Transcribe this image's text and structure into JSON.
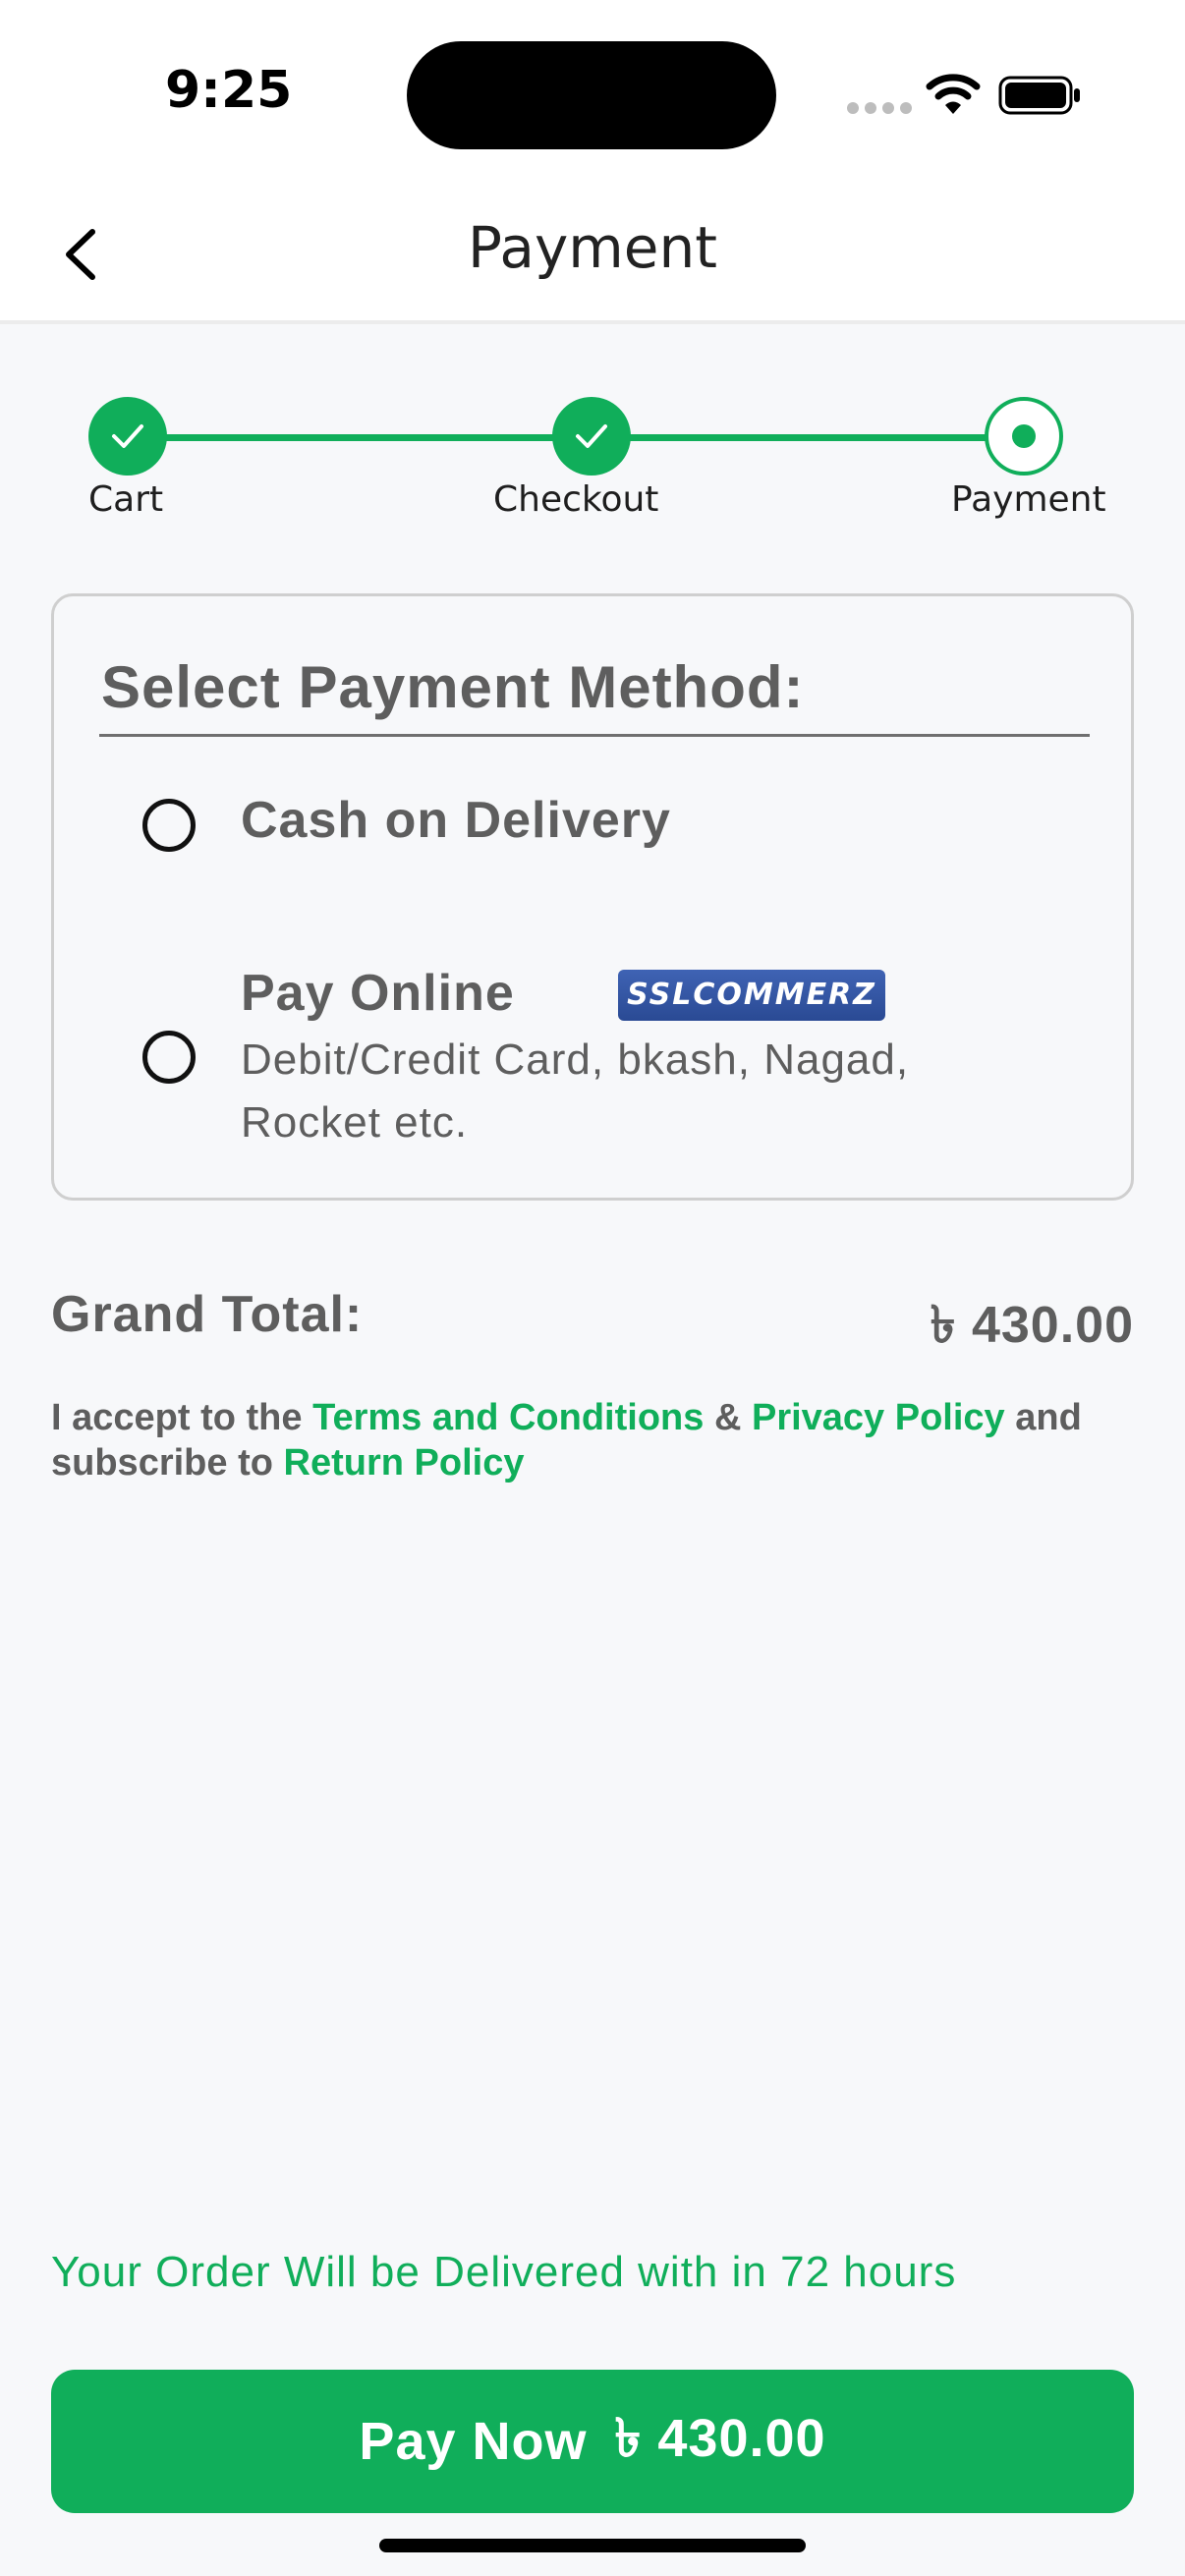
{
  "status_bar": {
    "time": "9:25"
  },
  "nav": {
    "title": "Payment",
    "back_icon": "chevron-left-icon"
  },
  "stepper": {
    "accent_color": "#10ae5a",
    "steps": [
      {
        "label": "Cart",
        "state": "done"
      },
      {
        "label": "Checkout",
        "state": "done"
      },
      {
        "label": "Payment",
        "state": "current"
      }
    ]
  },
  "payment_card": {
    "heading": "Select Payment Method:",
    "options": [
      {
        "title": "Cash on Delivery",
        "selected": false
      },
      {
        "title": "Pay Online",
        "badge": "SSLCOMMERZ",
        "subtitle_line1": "Debit/Credit Card, bkash, Nagad,",
        "subtitle_line2": "Rocket etc.",
        "selected": false
      }
    ]
  },
  "totals": {
    "grand_label": "Grand Total:",
    "grand_value": "৳ 430.00"
  },
  "terms": {
    "prefix": "I accept to the",
    "terms_link": "Terms and Conditions",
    "amp": "&",
    "privacy_link": "Privacy Policy",
    "and": "and",
    "subscribe": "subscribe to",
    "return_link": "Return Policy"
  },
  "delivery_note": "Your Order Will be Delivered with in 72 hours",
  "pay_button": {
    "label": "Pay Now",
    "amount": "৳ 430.00"
  }
}
